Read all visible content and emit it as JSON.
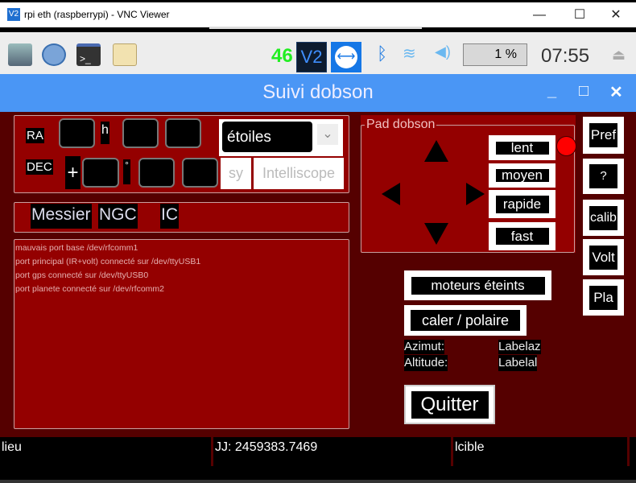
{
  "window": {
    "title": "rpi eth (raspberrypi) - VNC Viewer",
    "logo": "V2",
    "minimize": "—",
    "maximize": "☐",
    "close": "✕"
  },
  "taskbar": {
    "cpu_temp": "46",
    "vnc_logo": "V2",
    "cpu_percent": "1 %",
    "clock": "07:55",
    "icons": [
      "monitor-icon",
      "globe-icon",
      "terminal-icon",
      "folder-icon",
      "vnc-icon",
      "teamviewer-icon",
      "bluetooth-icon",
      "wifi-icon",
      "volume-icon",
      "eject-icon"
    ]
  },
  "app": {
    "title": "Suivi dobson",
    "minimize": "_",
    "maximize": "□",
    "close": "✕"
  },
  "coords": {
    "ra_label": "RA",
    "ra_h": "",
    "h_label": "h",
    "ra_m": "",
    "ra_s": "",
    "dec_label": "DEC",
    "dec_sign": "+",
    "dec_d": "",
    "deg_label": "°",
    "dec_m": "",
    "dec_s": "",
    "catalog_select": "étoiles",
    "sy_button": "sy",
    "intelliscope_button": "Intelliscope"
  },
  "catalogs": {
    "messier": "Messier",
    "ngc": "NGC",
    "ic": "IC"
  },
  "log": [
    "mauvais port base /dev/rfcomm1",
    "port principal (IR+volt) connecté sur /dev/ttyUSB1",
    "port gps connecté sur /dev/ttyUSB0",
    "port planete connecté sur /dev/rfcomm2"
  ],
  "pad": {
    "title": "Pad dobson",
    "speeds": [
      "lent",
      "moyen",
      "rapide",
      "fast"
    ],
    "indicator_color": "#ff0000"
  },
  "side": [
    "Pref",
    "?",
    "calib",
    "Volt",
    "Pla"
  ],
  "actions": {
    "motors": "moteurs éteints",
    "caler": "caler / polaire",
    "azimut_label": "Azimut:",
    "azimut_value": "Labelaz",
    "altitude_label": "Altitude:",
    "altitude_value": "Labelal",
    "quit": "Quitter"
  },
  "status": {
    "lieu": "lieu",
    "jj": "JJ: 2459383.7469",
    "cible": "lcible"
  },
  "colors": {
    "background": "#550000",
    "panel": "#940000",
    "titlebar": "#4a96f5"
  }
}
